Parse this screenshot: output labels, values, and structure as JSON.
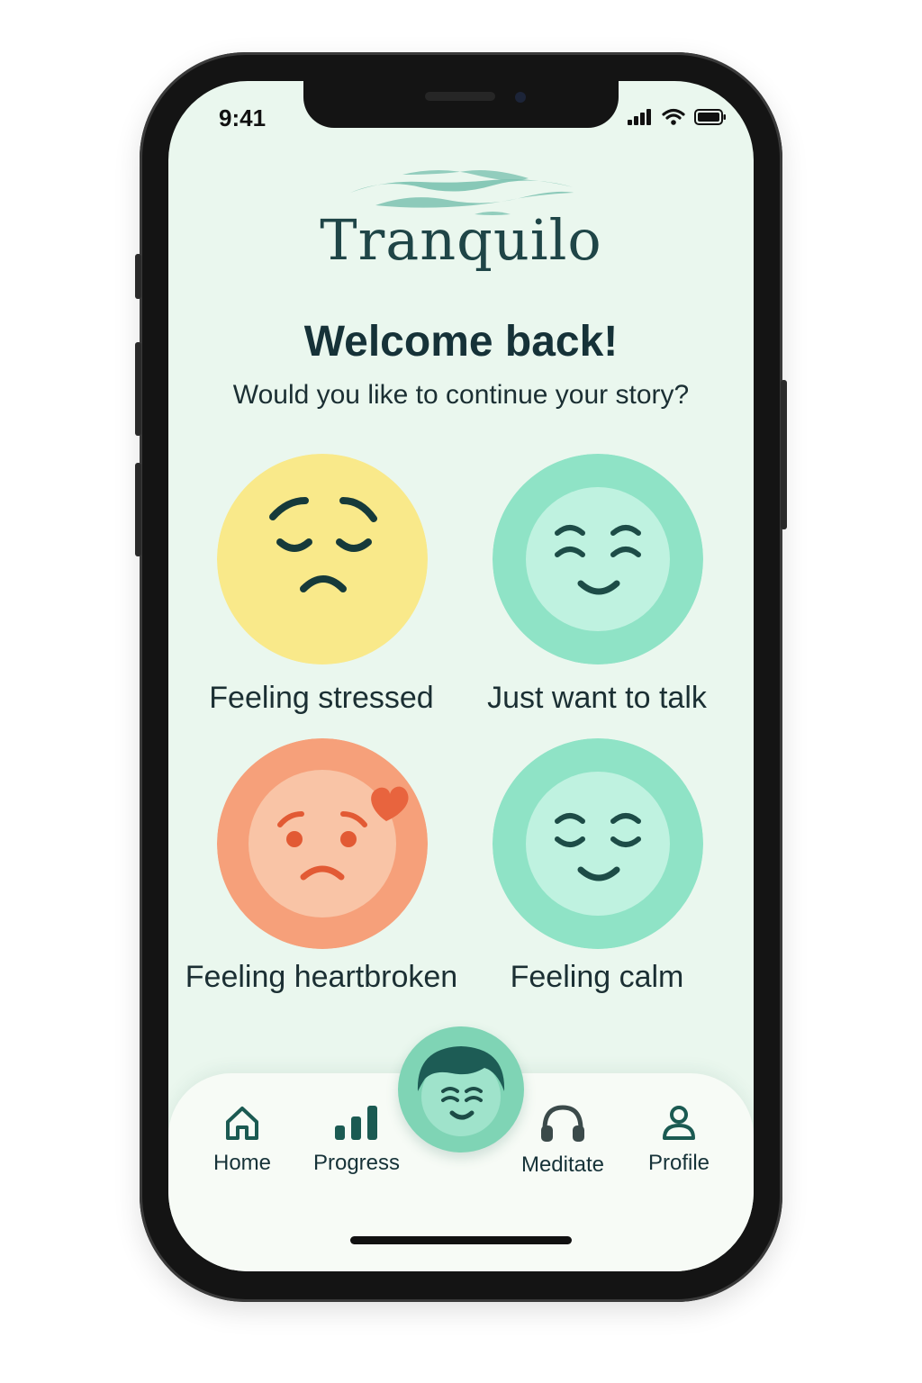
{
  "status": {
    "time": "9:41"
  },
  "app": {
    "name": "Tranquilo"
  },
  "header": {
    "welcome": "Welcome back!",
    "subtitle": "Would you like to continue your story?"
  },
  "moods": [
    {
      "label": "Feeling stressed",
      "icon": "worried-face-icon",
      "color": "#f9e98a"
    },
    {
      "label": "Just want to talk",
      "icon": "smiling-face-icon",
      "color": "#8fe3c6"
    },
    {
      "label": "Feeling heartbroken",
      "icon": "sad-face-heart-icon",
      "color": "#f6a07a"
    },
    {
      "label": "Feeling calm",
      "icon": "calm-face-icon",
      "color": "#8fe3c6"
    }
  ],
  "tabs": [
    {
      "label": "Home",
      "icon": "home-icon"
    },
    {
      "label": "Progress",
      "icon": "bar-chart-icon"
    },
    {
      "label": "Meditate",
      "icon": "headphones-icon"
    },
    {
      "label": "Profile",
      "icon": "person-icon"
    }
  ],
  "center_button": {
    "icon": "avatar-face-icon"
  },
  "colors": {
    "background": "#eaf7ee",
    "primary_text": "#163238",
    "accent_green": "#8fe3c6",
    "stress_yellow": "#f9e98a",
    "heartbreak_coral": "#f6a07a"
  }
}
